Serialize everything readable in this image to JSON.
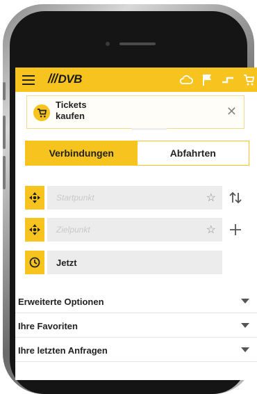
{
  "app": {
    "logo_text": "DVB",
    "logo_prefix": "///",
    "brand_color": "#f7c31f"
  },
  "ticket_banner": {
    "label": "Tickets\nkaufen",
    "close_symbol": "✕"
  },
  "tabs": [
    {
      "label": "Verbindungen",
      "active": true
    },
    {
      "label": "Abfahrten",
      "active": false
    }
  ],
  "form": {
    "start": {
      "placeholder": "Startpunkt"
    },
    "destination": {
      "placeholder": "Zielpunkt"
    },
    "time": {
      "value": "Jetzt"
    },
    "star_symbol": "☆"
  },
  "sections": [
    {
      "label": "Erweiterte Optionen"
    },
    {
      "label": "Ihre Favoriten"
    },
    {
      "label": "Ihre letzten Anfragen"
    }
  ],
  "icons": [
    "menu-icon",
    "cloud-icon",
    "flag-icon",
    "connection-icon",
    "cart-icon",
    "location-target-icon",
    "clock-icon",
    "swap-icon",
    "plus-icon",
    "close-icon",
    "star-icon",
    "caret-down-icon"
  ]
}
